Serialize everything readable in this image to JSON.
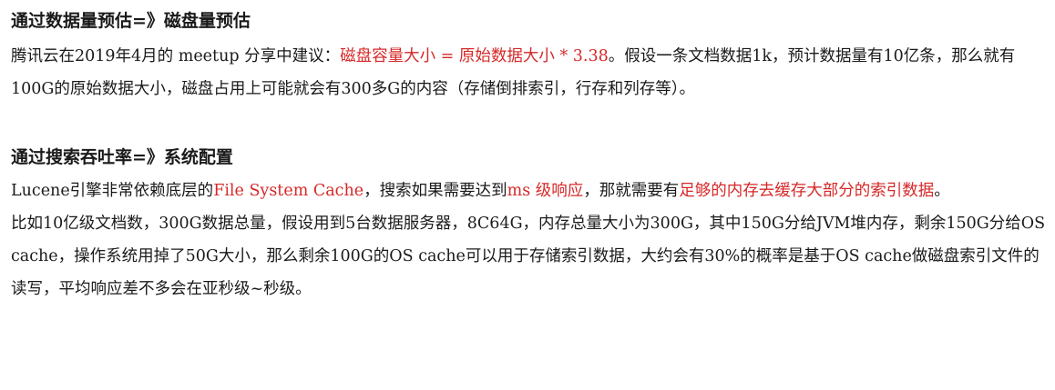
{
  "section1": {
    "heading": "通过数据量预估=》磁盘量预估",
    "para": {
      "text1": "腾讯云在2019年4月的 meetup 分享中建议：",
      "highlight": "磁盘容量大小 = 原始数据大小 * 3.38",
      "text2": "。假设一条文档数据1k，预计数据量有10亿条，那么就有100G的原始数据大小，磁盘占用上可能就会有300多G的内容（存储倒排索引，行存和列存等）。"
    }
  },
  "section2": {
    "heading": "通过搜索吞吐率=》系统配置",
    "para1": {
      "text1": "Lucene引擎非常依赖底层的",
      "highlight1": "File System Cache",
      "text2": "，搜索如果需要达到",
      "highlight2": "ms 级响应",
      "text3": "，那就需要有",
      "highlight3": "足够的内存去缓存大部分的索引数据",
      "text4": "。"
    },
    "para2": "比如10亿级文档数，300G数据总量，假设用到5台数据服务器，8C64G，内存总量大小为300G，其中150G分给JVM堆内存，剩余150G分给OS cache，操作系统用掉了50G大小，那么剩余100G的OS cache可以用于存储索引数据，大约会有30%的概率是基于OS cache做磁盘索引文件的读写，平均响应差不多会在亚秒级~秒级。"
  },
  "colors": {
    "highlight": "#d62828",
    "text": "#1a1a1a",
    "background": "#ffffff"
  }
}
